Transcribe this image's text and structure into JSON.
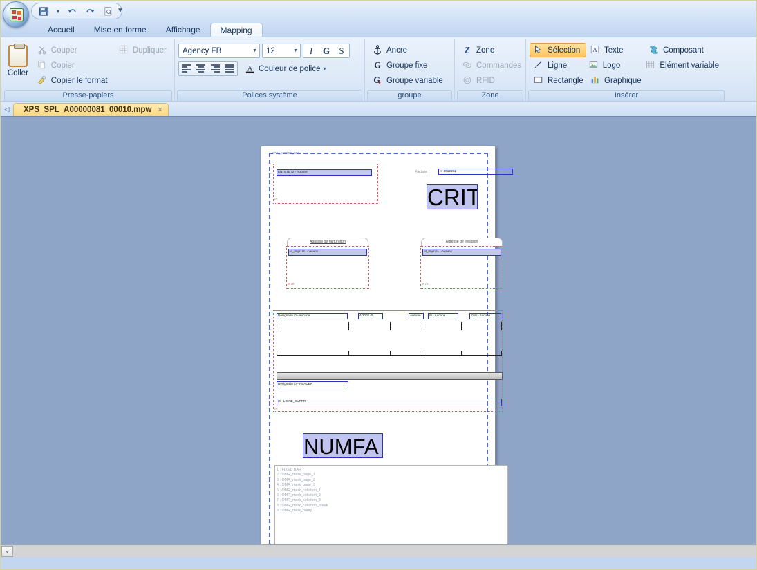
{
  "window": {
    "quick_access": [
      {
        "name": "save-icon",
        "label": "Enregistrer"
      },
      {
        "name": "undo-icon",
        "label": "Annuler"
      },
      {
        "name": "redo-icon",
        "label": "Rétablir"
      },
      {
        "name": "preview-icon",
        "label": "Aperçu"
      }
    ],
    "qat_more_label": "▼"
  },
  "ribbon": {
    "tabs": [
      {
        "label": "Accueil",
        "active": false
      },
      {
        "label": "Mise en forme",
        "active": false
      },
      {
        "label": "Affichage",
        "active": false
      },
      {
        "label": "Mapping",
        "active": true
      }
    ],
    "groups": [
      {
        "label": "Presse-papiers",
        "big_button": {
          "label": "Coller",
          "icon": "paste-icon"
        },
        "items": [
          {
            "label": "Couper",
            "icon": "scissors-icon",
            "disabled": true
          },
          {
            "label": "Dupliquer",
            "icon": "duplicate-icon",
            "disabled": true
          },
          {
            "label": "Copier",
            "icon": "copy-icon",
            "disabled": true
          },
          {
            "label": "Copier le format",
            "icon": "format-painter-icon",
            "disabled": false
          }
        ]
      },
      {
        "label": "Polices système",
        "font_name": "Agency FB",
        "font_size": "12",
        "italic_label": "I",
        "bold_label": "G",
        "underline_label": "S",
        "font_color_label": "Couleur de police",
        "font_color_caret": "▾",
        "align_labels": [
          "align-left",
          "align-center",
          "align-right",
          "align-justify"
        ]
      },
      {
        "label": "groupe",
        "items": [
          {
            "label": "Ancre",
            "icon": "anchor-icon",
            "disabled": false
          },
          {
            "label": "Groupe fixe",
            "icon": "fixed-group-icon",
            "disabled": false
          },
          {
            "label": "Groupe variable",
            "icon": "variable-group-icon",
            "disabled": false
          }
        ]
      },
      {
        "label": "Zone",
        "items": [
          {
            "label": "Zone",
            "icon": "zone-icon",
            "disabled": false
          },
          {
            "label": "Commandes",
            "icon": "commands-icon",
            "disabled": true
          },
          {
            "label": "RFID",
            "icon": "rfid-icon",
            "disabled": true
          }
        ]
      },
      {
        "label": "Insérer",
        "items": [
          {
            "label": "Sélection",
            "icon": "cursor-icon",
            "selected": true
          },
          {
            "label": "Texte",
            "icon": "text-icon",
            "selected": false
          },
          {
            "label": "Composant",
            "icon": "component-icon",
            "selected": false
          },
          {
            "label": "Ligne",
            "icon": "line-icon",
            "selected": false
          },
          {
            "label": "Logo",
            "icon": "logo-icon",
            "selected": false
          },
          {
            "label": "Elément variable",
            "icon": "variable-element-icon",
            "selected": false
          },
          {
            "label": "Rectangle",
            "icon": "rectangle-icon",
            "selected": false
          },
          {
            "label": "Graphique",
            "icon": "chart-icon",
            "selected": false
          }
        ]
      }
    ]
  },
  "document_tabs": {
    "nav_left": "◁",
    "items": [
      {
        "label": "XPS_SPL_A00000081_00010.mpw",
        "close": "×",
        "active": true
      }
    ]
  },
  "page": {
    "area_label": "XPS_A00000_SPL",
    "header_box_field": "ENTETE /2 - Aucune",
    "invoice_label": "Facture :",
    "invoice_field": "n° 0012601",
    "title_selected": "CRIT",
    "billing_tab": "Adresse de facturation",
    "billing_field": "M_Impri /0 - Aucune",
    "delivery_tab": "Adresse de livraison",
    "delivery_field": "M_Impri /1 - Aucune",
    "table_fields": [
      "Désignatio /0 - Aucune",
      "4/2002 /0",
      "Aucune",
      "/0 - Aucune",
      "/0 /0 - Aucune"
    ],
    "table_header_field": "Désignatio /0 - HEADER",
    "line_suppr_field": "/0 - LIGNE_SUPPR",
    "numfa_selected": "NUMFA",
    "omr_title": "",
    "omr_items": [
      "1 : FIXED BAR",
      "2 : OMR_mark_page_1",
      "3 : OMR_mark_page_2",
      "4 : OMR_mark_page_3",
      "5 : OMR_mark_collation_1",
      "6 : OMR_mark_collation_2",
      "7 : OMR_mark_collation_3",
      "8 : OMR_mark_collation_break",
      "9 : OMR_mark_parity"
    ]
  },
  "scrollbar": {
    "left_arrow": "‹"
  },
  "colors": {
    "accent": "#2a33c8",
    "selection_fill": "#c0c4ee",
    "guide_red": "#e35b5b",
    "canvas": "#8ea5c8",
    "tab_active": "#fcd980",
    "highlight_orange": "#fec45c"
  }
}
